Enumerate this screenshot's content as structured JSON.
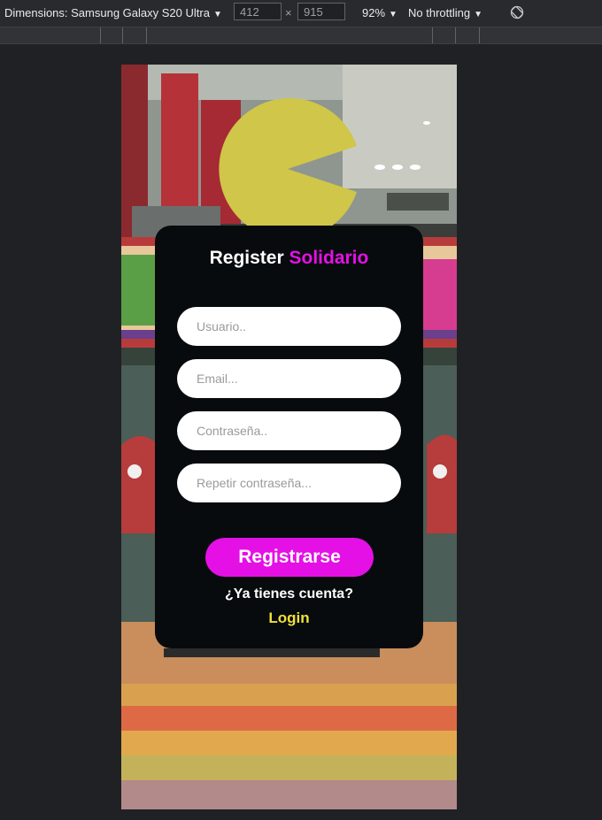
{
  "devtools": {
    "device_label": "Dimensions: Samsung Galaxy S20 Ultra",
    "width_value": "412",
    "height_value": "915",
    "times_symbol": "×",
    "zoom_label": "92%",
    "throttling_label": "No throttling",
    "caret": "▼",
    "rotate_icon": "rotate-icon"
  },
  "form": {
    "title_main": "Register",
    "title_accent": "Solidario",
    "username_placeholder": "Usuario..",
    "email_placeholder": "Email...",
    "password_placeholder": "Contraseña..",
    "repeat_password_placeholder": "Repetir contraseña...",
    "submit_label": "Registrarse",
    "have_account_text": "¿Ya tienes cuenta?",
    "login_label": "Login"
  },
  "colors": {
    "accent": "#e510e5",
    "card_background": "#070b0d",
    "login_link": "#f1e03a"
  }
}
